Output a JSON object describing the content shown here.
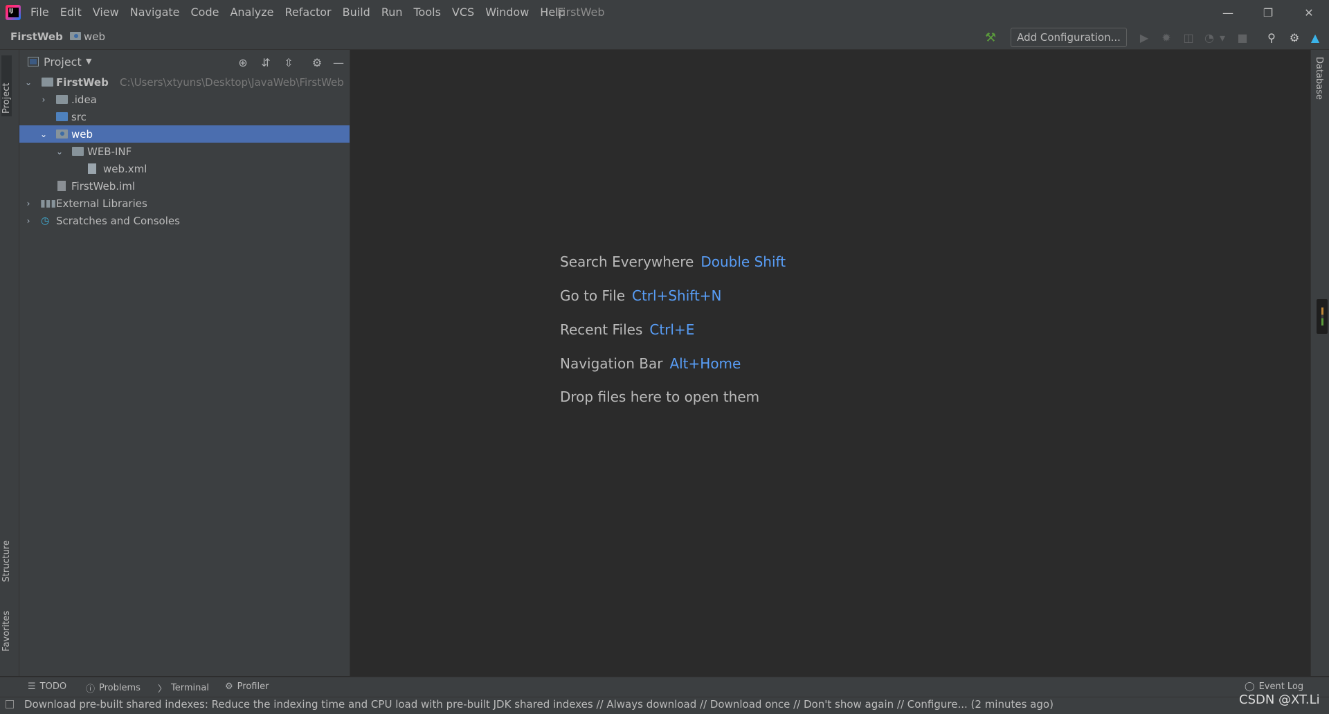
{
  "window": {
    "title": "FirstWeb",
    "controls": [
      "minimize",
      "restore",
      "close"
    ]
  },
  "menu": [
    "File",
    "Edit",
    "View",
    "Navigate",
    "Code",
    "Analyze",
    "Refactor",
    "Build",
    "Run",
    "Tools",
    "VCS",
    "Window",
    "Help"
  ],
  "breadcrumb": {
    "project": "FirstWeb",
    "folder": "web"
  },
  "toolbar": {
    "add_configuration": "Add Configuration...",
    "icons": [
      "build-hammer-icon",
      "run-icon",
      "debug-icon",
      "coverage-icon",
      "profile-icon",
      "stop-icon",
      "search-icon",
      "settings-icon",
      "code-with-me-icon"
    ]
  },
  "left_strip": {
    "project": "Project",
    "structure": "Structure",
    "favorites": "Favorites"
  },
  "right_strip": {
    "database": "Database"
  },
  "project_panel": {
    "title": "Project",
    "tree": [
      {
        "label": "FirstWeb",
        "path": "C:\\Users\\xtyuns\\Desktop\\JavaWeb\\FirstWeb",
        "type": "project-module",
        "expanded": true
      },
      {
        "label": ".idea",
        "type": "folder",
        "expanded": false
      },
      {
        "label": "src",
        "type": "source-folder"
      },
      {
        "label": "web",
        "type": "web-folder",
        "expanded": true,
        "selected": true
      },
      {
        "label": "WEB-INF",
        "type": "folder",
        "expanded": true
      },
      {
        "label": "web.xml",
        "type": "xml-file"
      },
      {
        "label": "FirstWeb.iml",
        "type": "iml-file"
      },
      {
        "label": "External Libraries",
        "type": "libraries",
        "expanded": false
      },
      {
        "label": "Scratches and Consoles",
        "type": "scratches",
        "expanded": false
      }
    ]
  },
  "editor_hints": [
    {
      "label": "Search Everywhere",
      "key": "Double Shift"
    },
    {
      "label": "Go to File",
      "key": "Ctrl+Shift+N"
    },
    {
      "label": "Recent Files",
      "key": "Ctrl+E"
    },
    {
      "label": "Navigation Bar",
      "key": "Alt+Home"
    },
    {
      "label": "Drop files here to open them",
      "key": ""
    }
  ],
  "bottom_tabs": [
    "TODO",
    "Problems",
    "Terminal",
    "Profiler"
  ],
  "event_log": "Event Log",
  "status": "Download pre-built shared indexes: Reduce the indexing time and CPU load with pre-built JDK shared indexes // Always download // Download once // Don't show again // Configure... (2 minutes ago)",
  "watermark": "CSDN @XT.Li",
  "colors": {
    "accent": "#4b6eaf",
    "shortcut": "#589df6",
    "background": "#2b2b2b",
    "panel": "#3c3f41"
  }
}
